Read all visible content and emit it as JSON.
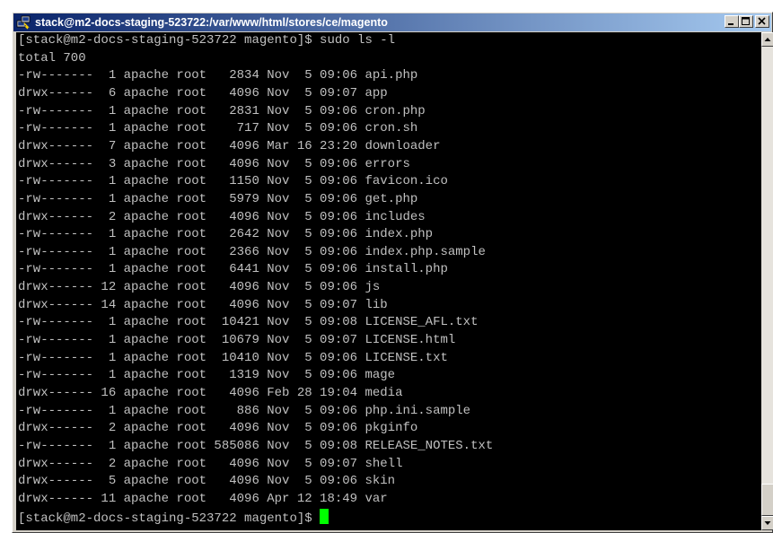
{
  "window": {
    "title": "stack@m2-docs-staging-523722:/var/www/html/stores/ce/magento",
    "app_icon": "putty-icon",
    "minimize_icon": "minimize-icon",
    "maximize_icon": "maximize-icon",
    "close_icon": "close-icon"
  },
  "terminal": {
    "background": "#000000",
    "foreground": "#c0c0c0",
    "cursor_color": "#00ff00",
    "command_line": "[stack@m2-docs-staging-523722 magento]$ sudo ls -l",
    "total": "total 700",
    "listing": [
      "-rw-------  1 apache root   2834 Nov  5 09:06 api.php",
      "drwx------  6 apache root   4096 Nov  5 09:07 app",
      "-rw-------  1 apache root   2831 Nov  5 09:06 cron.php",
      "-rw-------  1 apache root    717 Nov  5 09:06 cron.sh",
      "drwx------  7 apache root   4096 Mar 16 23:20 downloader",
      "drwx------  3 apache root   4096 Nov  5 09:06 errors",
      "-rw-------  1 apache root   1150 Nov  5 09:06 favicon.ico",
      "-rw-------  1 apache root   5979 Nov  5 09:06 get.php",
      "drwx------  2 apache root   4096 Nov  5 09:06 includes",
      "-rw-------  1 apache root   2642 Nov  5 09:06 index.php",
      "-rw-------  1 apache root   2366 Nov  5 09:06 index.php.sample",
      "-rw-------  1 apache root   6441 Nov  5 09:06 install.php",
      "drwx------ 12 apache root   4096 Nov  5 09:06 js",
      "drwx------ 14 apache root   4096 Nov  5 09:07 lib",
      "-rw-------  1 apache root  10421 Nov  5 09:08 LICENSE_AFL.txt",
      "-rw-------  1 apache root  10679 Nov  5 09:07 LICENSE.html",
      "-rw-------  1 apache root  10410 Nov  5 09:06 LICENSE.txt",
      "-rw-------  1 apache root   1319 Nov  5 09:06 mage",
      "drwx------ 16 apache root   4096 Feb 28 19:04 media",
      "-rw-------  1 apache root    886 Nov  5 09:06 php.ini.sample",
      "drwx------  2 apache root   4096 Nov  5 09:06 pkginfo",
      "-rw-------  1 apache root 585086 Nov  5 09:08 RELEASE_NOTES.txt",
      "drwx------  2 apache root   4096 Nov  5 09:07 shell",
      "drwx------  5 apache root   4096 Nov  5 09:06 skin",
      "drwx------ 11 apache root   4096 Apr 12 18:49 var"
    ],
    "prompt": "[stack@m2-docs-staging-523722 magento]$ "
  },
  "scrollbar": {
    "position": 1.0,
    "up_icon": "scroll-up-arrow-icon",
    "down_icon": "scroll-down-arrow-icon"
  }
}
